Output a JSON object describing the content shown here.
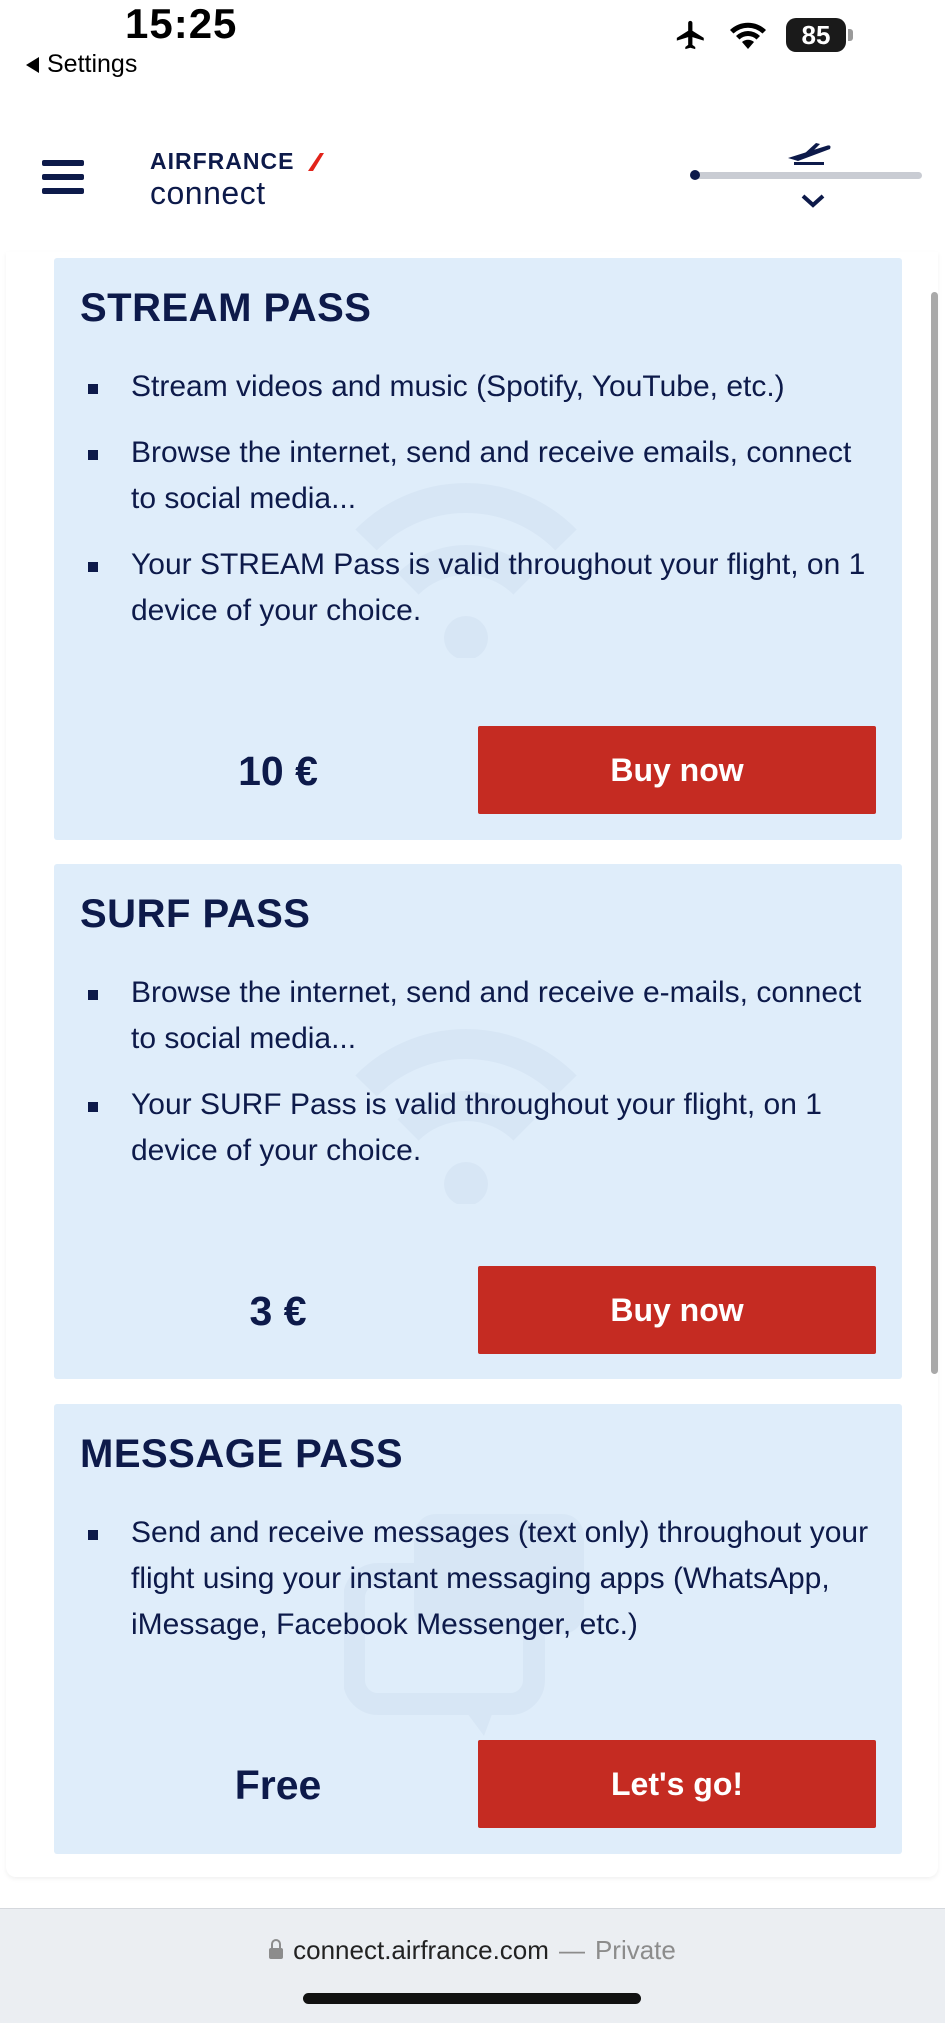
{
  "status_bar": {
    "time": "15:25",
    "back_label": "Settings",
    "battery": "85",
    "icons": [
      "airplane-mode-icon",
      "wifi-icon",
      "battery-icon"
    ]
  },
  "header": {
    "logo_top": "AIRFRANCE",
    "logo_bottom": "connect",
    "menu_icon": "hamburger-menu-icon",
    "flight_icon": "airplane-takeoff-icon",
    "flight_progress": 0.0
  },
  "passes": [
    {
      "title": "STREAM PASS",
      "features": [
        "Stream videos and music (Spotify, YouTube, etc.)",
        "Browse the internet, send and receive emails, connect to social media...",
        "Your STREAM Pass is valid throughout your flight, on 1 device of your choice."
      ],
      "price": "10 €",
      "button": "Buy now",
      "watermark_icon": "wifi-icon"
    },
    {
      "title": "SURF PASS",
      "features": [
        "Browse the internet, send and receive e-mails, connect to social media...",
        "Your SURF Pass is valid throughout your flight, on 1 device of your choice."
      ],
      "price": "3 €",
      "button": "Buy now",
      "watermark_icon": "wifi-icon"
    },
    {
      "title": "MESSAGE PASS",
      "features": [
        "Send and receive messages (text only) throughout your flight using your instant messaging apps (WhatsApp, iMessage, Facebook Messenger, etc.)"
      ],
      "price": "Free",
      "button": "Let's go!",
      "watermark_icon": "chat-bubbles-icon"
    }
  ],
  "url_bar": {
    "domain": "connect.airfrance.com",
    "separator": "—",
    "mode": "Private"
  },
  "colors": {
    "navy": "#0d1a4a",
    "card_bg": "#dfedfa",
    "button_red": "#c52b22",
    "logo_red": "#e2231a"
  }
}
